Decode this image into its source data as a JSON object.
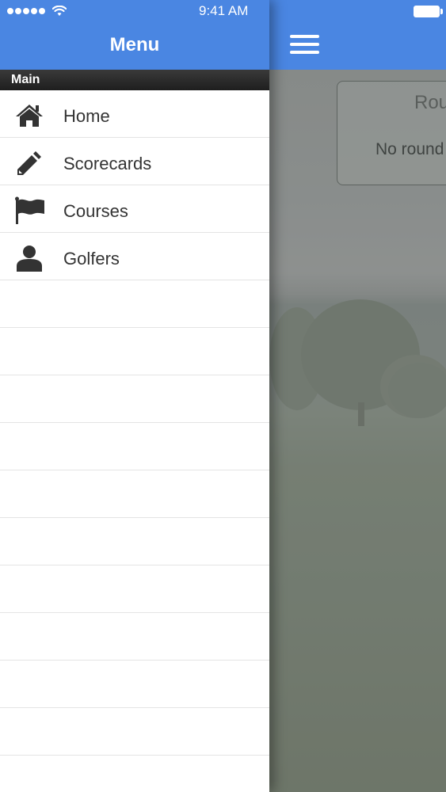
{
  "status_bar": {
    "time": "9:41 AM",
    "signal_icon": "signal-dots-icon",
    "wifi_icon": "wifi-icon",
    "battery_icon": "battery-icon"
  },
  "drawer": {
    "title": "Menu",
    "section": "Main",
    "items": [
      {
        "label": "Home",
        "icon": "home-icon"
      },
      {
        "label": "Scorecards",
        "icon": "pencil-icon"
      },
      {
        "label": "Courses",
        "icon": "flag-icon"
      },
      {
        "label": "Golfers",
        "icon": "person-icon"
      }
    ]
  },
  "main": {
    "menu_icon": "hamburger-icon",
    "rounds_card": {
      "title": "Rou",
      "empty_text": "No round"
    }
  },
  "colors": {
    "header_blue": "#4a86e2",
    "section_dark": "#222222",
    "icon_dark": "#333333"
  }
}
